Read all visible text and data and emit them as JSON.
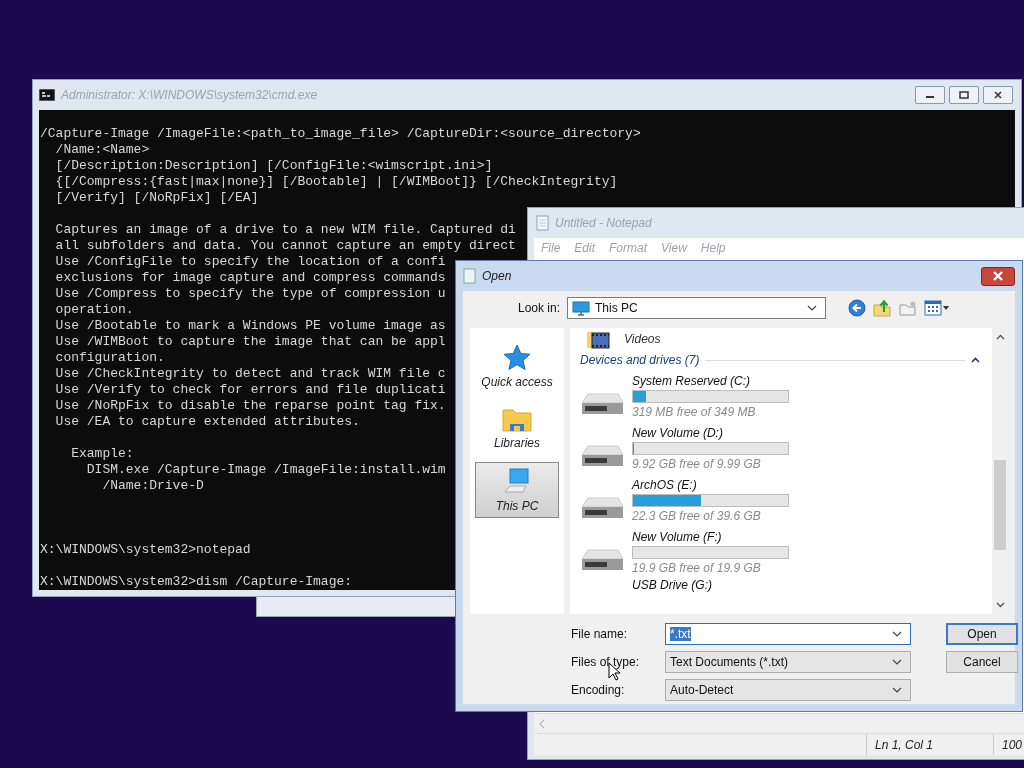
{
  "cmd_window": {
    "title": "Administrator: X:\\WINDOWS\\system32\\cmd.exe",
    "blocks": [
      {
        "kind": "help",
        "lines": [
          "/Capture-Image /ImageFile:<path_to_image_file> /CaptureDir:<source_directory>",
          "  /Name:<Name>",
          "  [/Description:Description] [/ConfigFile:<wimscript.ini>]",
          "  {[/Compress:{fast|max|none}] [/Bootable] | [/WIMBoot]} [/CheckIntegrity]",
          "  [/Verify] [/NoRpFix] [/EA]"
        ]
      },
      {
        "kind": "help",
        "lines": [
          "  Captures an image of a drive to a new WIM file. Captured di",
          "  all subfolders and data. You cannot capture an empty direct",
          "  Use /ConfigFile to specify the location of a confi",
          "  exclusions for image capture and compress commands",
          "  Use /Compress to specify the type of compression u",
          "  operation.",
          "  Use /Bootable to mark a Windows PE volume image as",
          "  Use /WIMBoot to capture the image that can be appl",
          "  configuration.",
          "  Use /CheckIntegrity to detect and track WIM file c",
          "  Use /Verify to check for errors and file duplicati",
          "  Use /NoRpFix to disable the reparse point tag fix.",
          "  Use /EA to capture extended attributes."
        ]
      },
      {
        "kind": "help",
        "lines": [
          "    Example:",
          "      DISM.exe /Capture-Image /ImageFile:install.wim",
          "        /Name:Drive-D"
        ]
      },
      {
        "kind": "prompt",
        "lines": [
          "X:\\WINDOWS\\system32>notepad"
        ]
      },
      {
        "kind": "prompt",
        "lines": [
          "X:\\WINDOWS\\system32>dism /Capture-Image:"
        ]
      }
    ]
  },
  "notepad_window": {
    "title": "Untitled - Notepad",
    "menu": [
      "File",
      "Edit",
      "Format",
      "View",
      "Help"
    ],
    "status_bar": {
      "position": "Ln 1, Col 1",
      "zoom": "100"
    }
  },
  "open_dialog": {
    "title": "Open",
    "look_in": {
      "label": "Look in:",
      "value": "This PC"
    },
    "places": [
      {
        "kind": "quick_access",
        "label": "Quick access",
        "selected": false
      },
      {
        "kind": "libraries",
        "label": "Libraries",
        "selected": false
      },
      {
        "kind": "pc",
        "label": "This PC",
        "selected": true
      }
    ],
    "items": [
      {
        "kind": "folder",
        "name": "Videos"
      },
      {
        "kind": "group",
        "name": "Devices and drives (7)",
        "expanded": true
      },
      {
        "kind": "drive",
        "name": "System Reserved (C:)",
        "level": 0.086,
        "free": "319 MB free of 349 MB"
      },
      {
        "kind": "drive",
        "name": "New Volume (D:)",
        "level": 0.007,
        "free": "9.92 GB free of 9.99 GB"
      },
      {
        "kind": "drive",
        "name": "ArchOS (E:)",
        "level": 0.437,
        "free": "22.3 GB free of 39.6 GB"
      },
      {
        "kind": "drive",
        "name": "New Volume (F:)",
        "free": "19.9 GB free of 19.9 GB"
      },
      {
        "kind": "drive_cut",
        "name": "USB Drive (G:)"
      }
    ],
    "fields": [
      {
        "kind": "edit",
        "label": "File name:",
        "value": "*.txt"
      },
      {
        "kind": "combo",
        "label": "Files of type:",
        "value": "Text Documents (*.txt)"
      },
      {
        "kind": "combo",
        "label": "Encoding:",
        "value": "Auto-Detect"
      }
    ],
    "buttons": [
      {
        "label": "Open",
        "default": true
      },
      {
        "label": "Cancel",
        "default": false
      }
    ]
  }
}
